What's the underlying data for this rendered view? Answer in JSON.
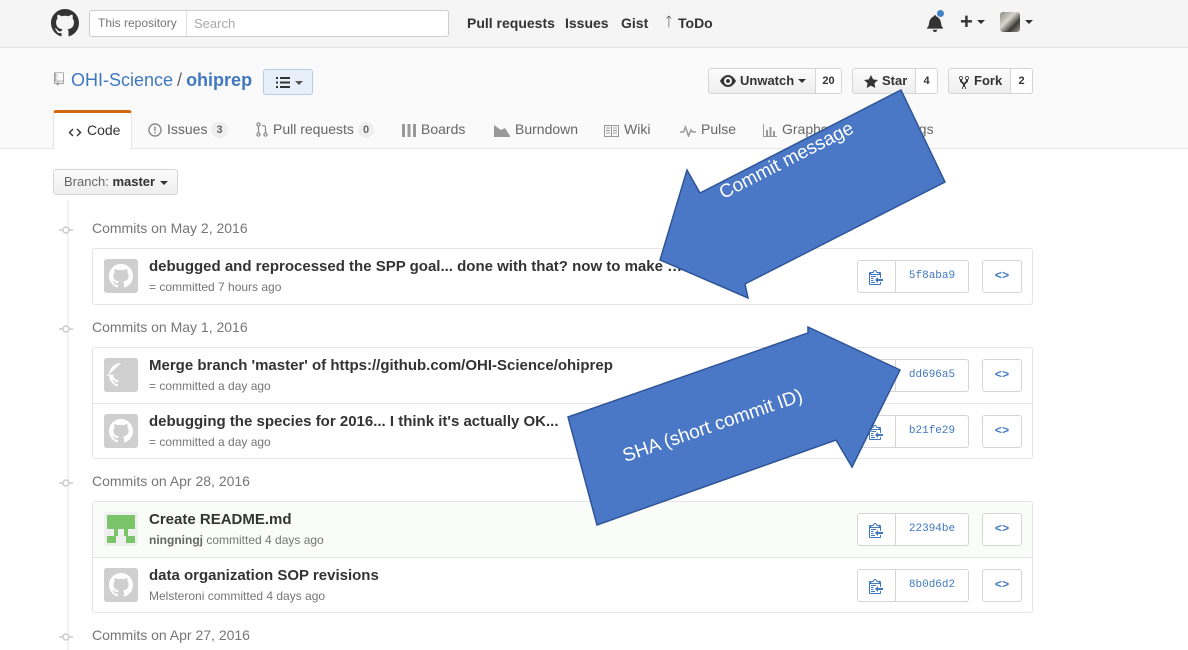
{
  "header": {
    "search_scope": "This repository",
    "search_placeholder": "Search",
    "nav": [
      "Pull requests",
      "Issues",
      "Gist",
      "ToDo"
    ]
  },
  "repo": {
    "owner": "OHI-Science",
    "separator": "/",
    "name": "ohiprep",
    "actions": {
      "watch_label": "Unwatch",
      "watch_count": "20",
      "star_label": "Star",
      "star_count": "4",
      "fork_label": "Fork",
      "fork_count": "2"
    },
    "tabs": [
      {
        "label": "Code",
        "selected": true
      },
      {
        "label": "Issues",
        "count": "3"
      },
      {
        "label": "Pull requests",
        "count": "0"
      },
      {
        "label": "Boards"
      },
      {
        "label": "Burndown"
      },
      {
        "label": "Wiki"
      },
      {
        "label": "Pulse"
      },
      {
        "label": "Graphs"
      },
      {
        "label": "Settings"
      }
    ]
  },
  "branch": {
    "prefix": "Branch:",
    "name": "master"
  },
  "commit_groups": [
    {
      "title": "Commits on May 2, 2016",
      "commits": [
        {
          "message": "debugged and reprocessed the SPP goal... done with that? now to make …",
          "author": "",
          "meta": "= committed 7 hours ago",
          "sha": "5f8aba9"
        }
      ]
    },
    {
      "title": "Commits on May 1, 2016",
      "commits": [
        {
          "message": "Merge branch 'master' of https://github.com/OHI-Science/ohiprep",
          "author": "",
          "meta": "= committed a day ago",
          "sha": "dd696a5"
        },
        {
          "message": "debugging the species for 2016... I think it's actually OK...",
          "author": "",
          "meta": "= committed a day ago",
          "sha": "b21fe29"
        }
      ]
    },
    {
      "title": "Commits on Apr 28, 2016",
      "commits": [
        {
          "message": "Create README.md",
          "author": "ningningj",
          "meta": "committed 4 days ago",
          "sha": "22394be"
        },
        {
          "message": "data organization SOP revisions",
          "author": "",
          "meta": "Melsteroni committed 4 days ago",
          "sha": "8b0d6d2"
        }
      ]
    },
    {
      "title": "Commits on Apr 27, 2016",
      "commits": []
    }
  ],
  "browse_label": "<>",
  "annotations": {
    "commit_message": "Commit message",
    "sha": "SHA (short commit ID)",
    "arrow_color": "#4a78c6"
  }
}
